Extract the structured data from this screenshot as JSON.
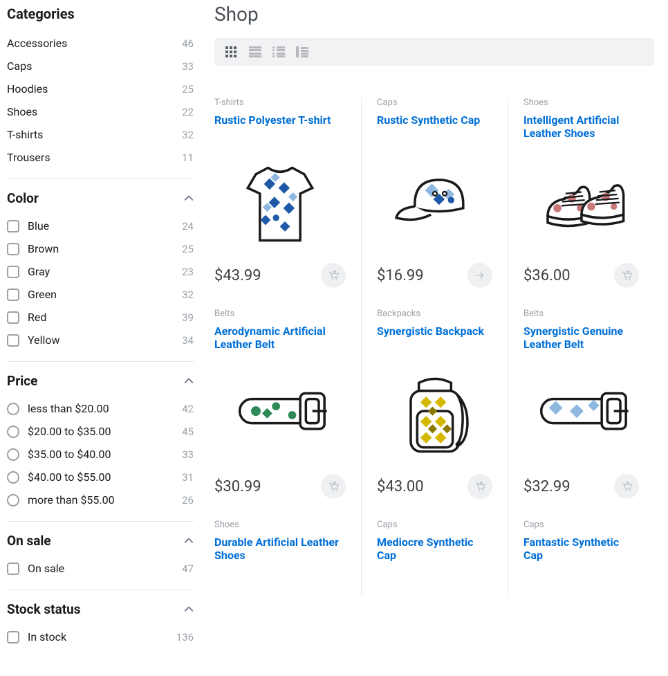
{
  "page": {
    "title": "Shop"
  },
  "sidebar": {
    "categories_title": "Categories",
    "categories": [
      {
        "name": "Accessories",
        "count": "46"
      },
      {
        "name": "Caps",
        "count": "33"
      },
      {
        "name": "Hoodies",
        "count": "25"
      },
      {
        "name": "Shoes",
        "count": "22"
      },
      {
        "name": "T-shirts",
        "count": "32"
      },
      {
        "name": "Trousers",
        "count": "11"
      }
    ],
    "color_title": "Color",
    "colors": [
      {
        "name": "Blue",
        "count": "24"
      },
      {
        "name": "Brown",
        "count": "25"
      },
      {
        "name": "Gray",
        "count": "23"
      },
      {
        "name": "Green",
        "count": "32"
      },
      {
        "name": "Red",
        "count": "39"
      },
      {
        "name": "Yellow",
        "count": "34"
      }
    ],
    "price_title": "Price",
    "prices": [
      {
        "label": "less than $20.00",
        "count": "42"
      },
      {
        "label": "$20.00 to $35.00",
        "count": "45"
      },
      {
        "label": "$35.00 to $40.00",
        "count": "33"
      },
      {
        "label": "$40.00 to $55.00",
        "count": "31"
      },
      {
        "label": "more than $55.00",
        "count": "26"
      }
    ],
    "onsale_title": "On sale",
    "onsale": [
      {
        "label": "On sale",
        "count": "47"
      }
    ],
    "stock_title": "Stock status",
    "stock": [
      {
        "label": "In stock",
        "count": "136"
      }
    ]
  },
  "products": [
    {
      "category": "T-shirts",
      "name": "Rustic Polyester T-shirt",
      "price": "$43.99",
      "icon": "tshirt"
    },
    {
      "category": "Caps",
      "name": "Rustic Synthetic Cap",
      "price": "$16.99",
      "icon": "cap",
      "action": "arrow"
    },
    {
      "category": "Shoes",
      "name": "Intelligent Artificial Leather Shoes",
      "price": "$36.00",
      "icon": "shoes"
    },
    {
      "category": "Belts",
      "name": "Aerodynamic Artificial Leather Belt",
      "price": "$30.99",
      "icon": "belt-green"
    },
    {
      "category": "Backpacks",
      "name": "Synergistic Backpack",
      "price": "$43.00",
      "icon": "backpack"
    },
    {
      "category": "Belts",
      "name": "Synergistic Genuine Leather Belt",
      "price": "$32.99",
      "icon": "belt-blue"
    },
    {
      "category": "Shoes",
      "name": "Durable Artificial Leather Shoes",
      "price": "",
      "icon": ""
    },
    {
      "category": "Caps",
      "name": "Mediocre Synthetic Cap",
      "price": "",
      "icon": ""
    },
    {
      "category": "Caps",
      "name": "Fantastic Synthetic Cap",
      "price": "",
      "icon": ""
    }
  ]
}
